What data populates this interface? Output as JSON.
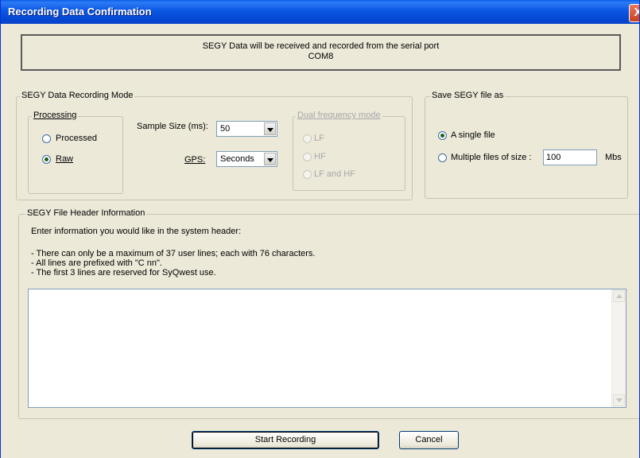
{
  "window": {
    "title": "Recording Data Confirmation",
    "close_glyph": "X"
  },
  "banner": {
    "line1": "SEGY Data will be received and recorded from the serial port",
    "line2": "COM8"
  },
  "recording_mode": {
    "legend": "SEGY Data Recording Mode",
    "processing": {
      "legend": "Processing",
      "options": [
        {
          "label": "Processed",
          "checked": false
        },
        {
          "label": "Raw",
          "checked": true
        }
      ]
    },
    "sample_size": {
      "label": "Sample Size (ms):",
      "value": "50"
    },
    "gps": {
      "label": "GPS:",
      "value": "Seconds"
    },
    "dual_frequency": {
      "legend": "Dual frequency mode",
      "options": [
        {
          "label": "LF",
          "enabled": false
        },
        {
          "label": "HF",
          "enabled": false
        },
        {
          "label": "LF and HF",
          "enabled": false
        }
      ]
    }
  },
  "save_as": {
    "legend": "Save SEGY file as",
    "single_file": {
      "label": "A single file",
      "checked": true
    },
    "multiple_files": {
      "label": "Multiple files of size :",
      "checked": false,
      "value": "100",
      "unit": "Mbs"
    }
  },
  "header_info": {
    "legend": "SEGY File Header Information",
    "intro": "Enter information you would like in the system header:",
    "notes": [
      "- There can only be a maximum of 37 user lines; each with 76 characters.",
      "- All lines are prefixed with \"C nn\".",
      "- The first 3 lines are reserved for SyQwest use."
    ],
    "text_value": ""
  },
  "buttons": {
    "start": "Start Recording",
    "cancel": "Cancel"
  },
  "icons": {
    "close": "close-icon",
    "dropdown": "chevron-down-icon",
    "scroll_up": "scroll-up-icon",
    "scroll_down": "scroll-down-icon"
  }
}
